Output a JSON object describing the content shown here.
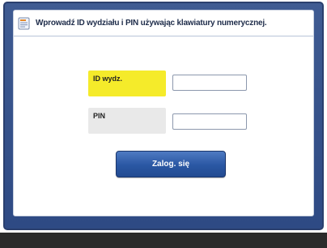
{
  "dialog": {
    "title": "Wprowadź ID wydziału i PIN używając klawiatury numerycznej.",
    "icon": "info-icon"
  },
  "fields": {
    "id_label": "ID wydz.",
    "id_value": "",
    "pin_label": "PIN",
    "pin_value": ""
  },
  "login_button": {
    "label": "Zalog. się"
  },
  "colors": {
    "frame": "#2e4a84",
    "active_label": "#f5eb2a",
    "inactive_label": "#e9e9e9",
    "button": "#2a57a3",
    "bottom_bar": "#2b2b2b"
  }
}
